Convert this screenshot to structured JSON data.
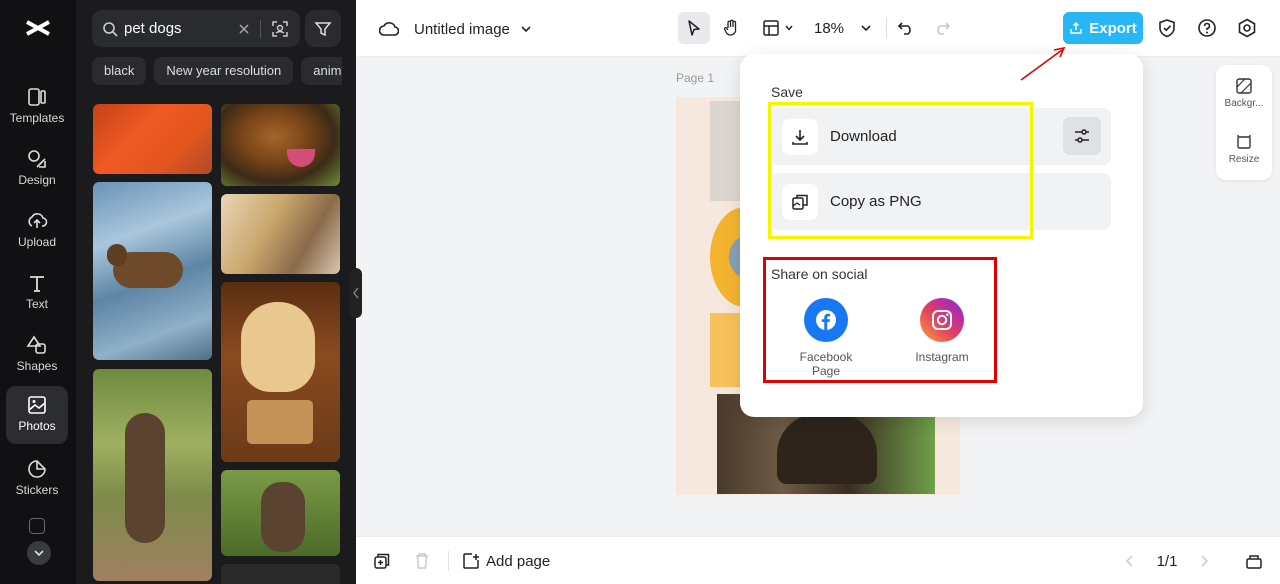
{
  "rail": {
    "items": [
      {
        "label": "Templates",
        "icon": "templates-icon"
      },
      {
        "label": "Design",
        "icon": "design-icon"
      },
      {
        "label": "Upload",
        "icon": "upload-icon"
      },
      {
        "label": "Text",
        "icon": "text-icon"
      },
      {
        "label": "Shapes",
        "icon": "shapes-icon"
      },
      {
        "label": "Photos",
        "icon": "photos-icon",
        "active": true
      },
      {
        "label": "Stickers",
        "icon": "stickers-icon"
      }
    ]
  },
  "panel": {
    "search_value": "pet dogs",
    "chips": [
      "black",
      "New year resolution",
      "anim"
    ]
  },
  "topbar": {
    "doc_title": "Untitled image",
    "zoom": "18%",
    "export_label": "Export"
  },
  "canvas": {
    "page_label": "Page 1"
  },
  "sidecard": {
    "background_label": "Backgr...",
    "resize_label": "Resize"
  },
  "bottombar": {
    "add_page_label": "Add page",
    "page_counter": "1/1"
  },
  "popup": {
    "save_title": "Save",
    "download_label": "Download",
    "copy_label": "Copy as PNG",
    "share_title": "Share on social",
    "facebook_label": "Facebook Page",
    "instagram_label": "Instagram"
  },
  "colors": {
    "accent": "#29b6f6",
    "highlight_yellow": "#f5f500",
    "highlight_red": "#e00000",
    "facebook": "#1877f2"
  }
}
